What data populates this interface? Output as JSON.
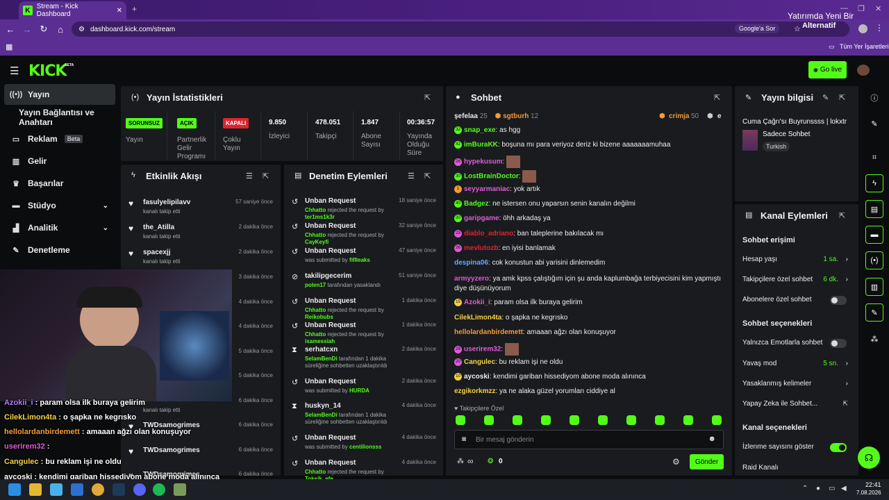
{
  "browser": {
    "tab_title": "Stream - Kick Dashboard",
    "url": "dashboard.kick.com/stream",
    "google_btn": "Google'a Sor",
    "bookmarks_label": "Tüm Yer İşaretleri",
    "ad_text_1": "Yatırımda Yeni Bir",
    "ad_text_2": "Alternatif"
  },
  "header": {
    "logo": "KICK",
    "beta": "BETA",
    "go_live": "Go live"
  },
  "sidebar": {
    "items": [
      {
        "label": "Yayın",
        "icon": "broadcast-icon"
      },
      {
        "label": "Yayın Bağlantısı ve Anahtarı",
        "icon": "key-icon"
      },
      {
        "label": "Reklam",
        "icon": "ad-icon",
        "badge": "Beta"
      },
      {
        "label": "Gelir",
        "icon": "chart-icon"
      },
      {
        "label": "Başarılar",
        "icon": "trophy-icon"
      },
      {
        "label": "Stüdyo",
        "icon": "studio-icon"
      },
      {
        "label": "Analitik",
        "icon": "analytics-icon"
      },
      {
        "label": "Denetleme",
        "icon": "wrench-icon"
      }
    ]
  },
  "stats": {
    "title": "Yayın İstatistikleri",
    "items": [
      {
        "badge": "SORUNSUZ",
        "badge_color": "#53fc18",
        "label": "Yayın"
      },
      {
        "badge": "AÇIK",
        "badge_color": "#53fc18",
        "label": "Partnerlik Gelir Programı"
      },
      {
        "badge": "KAPALI",
        "badge_color": "#e0242e",
        "label": "Çoklu Yayın"
      },
      {
        "value": "9.850",
        "label": "İzleyici"
      },
      {
        "value": "478.051",
        "label": "Takipçi"
      },
      {
        "value": "1.847",
        "label": "Abone Sayısı"
      },
      {
        "value": "00:36:57",
        "label": "Yayında Olduğu Süre"
      }
    ]
  },
  "activity": {
    "title": "Etkinlik Akışı",
    "rows": [
      {
        "name": "fasulyelipilavv",
        "sub": "kanalı takip etti",
        "time": "57 saniye önce"
      },
      {
        "name": "the_Atilla",
        "sub": "kanalı takip etti",
        "time": "2 dakika önce"
      },
      {
        "name": "spacexjj",
        "sub": "kanalı takip etti",
        "time": "2 dakika önce"
      },
      {
        "name": "",
        "sub": "",
        "time": "3 dakika önce"
      },
      {
        "name": "",
        "sub": "",
        "time": "4 dakika önce"
      },
      {
        "name": "",
        "sub": "",
        "time": "4 dakika önce"
      },
      {
        "name": "",
        "sub": "",
        "time": "5 dakika önce"
      },
      {
        "name": "",
        "sub": "",
        "time": "5 dakika önce"
      },
      {
        "name": "",
        "sub": "kanalı takip etti",
        "time": "6 dakika önce"
      },
      {
        "name": "TWDsamogrimes",
        "sub": "",
        "time": "6 dakika önce"
      },
      {
        "name": "TWDsamogrimes",
        "sub": "",
        "time": "6 dakika önce"
      },
      {
        "name": "TWDsamogrimes",
        "sub": "",
        "time": "6 dakika önce"
      }
    ]
  },
  "moderation": {
    "title": "Denetim Eylemleri",
    "rows": [
      {
        "icon": "undo-icon",
        "name": "Unban Request",
        "actor": "Chhatto",
        "mid": " rejected the request by ",
        "target": "ter1ms1k3r",
        "time": "18 saniye önce"
      },
      {
        "icon": "undo-icon",
        "name": "Unban Request",
        "actor": "Chhatto",
        "mid": " rejected the request by ",
        "target": "CayKeyfi",
        "time": "32 saniye önce"
      },
      {
        "icon": "undo-icon",
        "name": "Unban Request",
        "actor": "",
        "mid": "was submitted by ",
        "target": "fiflleaks",
        "time": "47 saniye önce"
      },
      {
        "icon": "ban-icon",
        "name": "takilipgecerim",
        "actor": "polen17",
        "mid": " tarafından yasaklandı",
        "target": "",
        "time": "51 saniye önce"
      },
      {
        "icon": "undo-icon",
        "name": "Unban Request",
        "actor": "Chhatto",
        "mid": " rejected the request by ",
        "target": "Reikobubs",
        "time": "1 dakika önce"
      },
      {
        "icon": "undo-icon",
        "name": "Unban Request",
        "actor": "Chhatto",
        "mid": " rejected the request by ",
        "target": "isamessiah",
        "time": "1 dakika önce"
      },
      {
        "icon": "hourglass-icon",
        "name": "serhatcxn",
        "actor": "SelamBenDi",
        "mid": " tarafından 1 dakika süreliğine sohbetten uzaklaştırıldı",
        "target": "",
        "time": "2 dakika önce"
      },
      {
        "icon": "undo-icon",
        "name": "Unban Request",
        "actor": "",
        "mid": "was submitted by ",
        "target": "HURDA",
        "time": "2 dakika önce"
      },
      {
        "icon": "hourglass-icon",
        "name": "huskyn_14",
        "actor": "SelamBenDi",
        "mid": " tarafından 1 dakika süreliğine sohbetten uzaklaştırıldı",
        "target": "",
        "time": "4 dakika önce"
      },
      {
        "icon": "undo-icon",
        "name": "Unban Request",
        "actor": "",
        "mid": "was submitted by ",
        "target": "centilionsss",
        "time": "4 dakika önce"
      },
      {
        "icon": "undo-icon",
        "name": "Unban Request",
        "actor": "Chhatto",
        "mid": " rejected the request by ",
        "target": "Toksik_efe",
        "time": "4 dakika önce"
      }
    ]
  },
  "chat": {
    "title": "Sohbet",
    "top_gifters": [
      {
        "name": "şefelaa",
        "count": "25"
      },
      {
        "name": "sgtburh",
        "count": "12"
      },
      {
        "name": "crimja",
        "count": "50"
      },
      {
        "name": "e",
        "count": ""
      }
    ],
    "messages": [
      {
        "badge": "32",
        "user": "snap_exe",
        "color": "#53fc18",
        "text": "as hgg"
      },
      {
        "badge": "42",
        "user": "imBuraKK",
        "color": "#53fc18",
        "text": "boşuna mı para veriyoz deriz ki bizene aaaaaaamuhaa"
      },
      {
        "badge": "26",
        "user": "hypekusum",
        "color": "#e05bd6",
        "text": "[emote]"
      },
      {
        "badge": "30",
        "user": "LostBrainDoctor",
        "color": "#53fc18",
        "text": "[emote]"
      },
      {
        "badge": "1",
        "user": "seyyarmaniac",
        "color": "#e05bd6",
        "text": "yok artık"
      },
      {
        "badge": "40",
        "user": "Badgez",
        "color": "#53fc18",
        "text": "ne istersen onu yaparsın senin kanalın değilmi"
      },
      {
        "badge": "30",
        "user": "garipgame",
        "color": "#e05bd6",
        "text": "öhh arkadaş ya"
      },
      {
        "badge": "23",
        "user": "diablo_adriano",
        "color": "#e0242e",
        "text": "ban taleplerine bakılacak mı"
      },
      {
        "badge": "26",
        "user": "mevlutozb",
        "color": "#e0242e",
        "text": "en iyisi banlamak"
      },
      {
        "badge": "",
        "user": "despina06",
        "color": "#6aa8ff",
        "text": "cok konustun abi yarisini dinlemedim"
      },
      {
        "badge": "",
        "user": "armyyzero",
        "color": "#e05bd6",
        "text": "ya amk kpss çalıştığım için şu anda kaplumbağa terbiyecisini kim yapmıştı diye düşünüyorum"
      },
      {
        "badge": "15",
        "user": "Azokii_i",
        "color": "#e05bd6",
        "text": "param olsa ilk buraya gelirim"
      },
      {
        "badge": "",
        "user": "CilekLimon4ta",
        "color": "#f5d142",
        "text": "o şapka ne kegrısko"
      },
      {
        "badge": "",
        "user": "hellolardanbirdemett",
        "color": "#f39b36",
        "text": "amaaan ağzı olan konuşuyor"
      },
      {
        "badge": "29",
        "user": "userirem32",
        "color": "#e05bd6",
        "text": "[emote]"
      },
      {
        "badge": "20",
        "user": "Cangulec",
        "color": "#f5d142",
        "text": "bu reklam işi ne oldu"
      },
      {
        "badge": "10",
        "user": "aycoski",
        "color": "#eeeeee",
        "text": "kendimi gariban hissediyom abone moda alınınca"
      },
      {
        "badge": "",
        "user": "ezgikorkmzz",
        "color": "#f5d142",
        "text": "ya ne alaka güzel yorumları ciddiye al"
      }
    ],
    "followers_only": "Takipçilere Özel",
    "input_placeholder": "Bir mesaj gönderin",
    "points": "∞",
    "coins": "0",
    "send_label": "Gönder"
  },
  "stream_info": {
    "title": "Yayın bilgisi",
    "stream_title": "Cuma Çağrı'sı Buyrunssss | lokxtr",
    "category": "Sadece Sohbet",
    "language": "Turkish"
  },
  "channel_actions": {
    "title": "Kanal Eylemleri",
    "chat_access_title": "Sohbet erişimi",
    "rows_access": [
      {
        "label": "Hesap yaşı",
        "value": "1 sa.",
        "type": "value"
      },
      {
        "label": "Takipçilere özel sohbet",
        "value": "6 dk.",
        "type": "value"
      },
      {
        "label": "Abonelere özel sohbet",
        "value": "",
        "type": "toggle",
        "on": false
      }
    ],
    "chat_options_title": "Sohbet seçenekleri",
    "rows_options": [
      {
        "label": "Yalnızca Emotlarla sohbet",
        "value": "",
        "type": "toggle",
        "on": false
      },
      {
        "label": "Yavaş mod",
        "value": "5 sn.",
        "type": "value"
      },
      {
        "label": "Yasaklanmış kelimeler",
        "value": "",
        "type": "chevron"
      },
      {
        "label": "Yapay Zeka ile Sohbet...",
        "value": "",
        "type": "external"
      }
    ],
    "channel_options_title": "Kanal seçenekleri",
    "rows_channel": [
      {
        "label": "İzlenme sayısını göster",
        "value": "",
        "type": "toggle",
        "on": true
      },
      {
        "label": "Raid Kanalı",
        "value": "",
        "type": "none"
      }
    ]
  },
  "overlay_chat": [
    {
      "user": "Azokii_i",
      "text": " : param olsa ilk buraya gelirim",
      "color": "#b57bff"
    },
    {
      "user": "CilekLimon4ta",
      "text": " : o şapka ne kegrısko",
      "color": "#f5d142"
    },
    {
      "user": "hellolardanbirdemett",
      "text": " : amaaan ağzı olan konuşuyor",
      "color": "#f39b36"
    },
    {
      "user": "userirem32",
      "text": " :",
      "color": "#e05bd6"
    },
    {
      "user": "Cangulec",
      "text": " : bu reklam işi ne oldu",
      "color": "#f5d142"
    },
    {
      "user": "aycoski",
      "text": " : kendimi gariban hissediyom abone moda alınınca",
      "color": "#ffffff"
    }
  ],
  "taskbar": {
    "time": "22:41",
    "date": "7.08.2026"
  }
}
